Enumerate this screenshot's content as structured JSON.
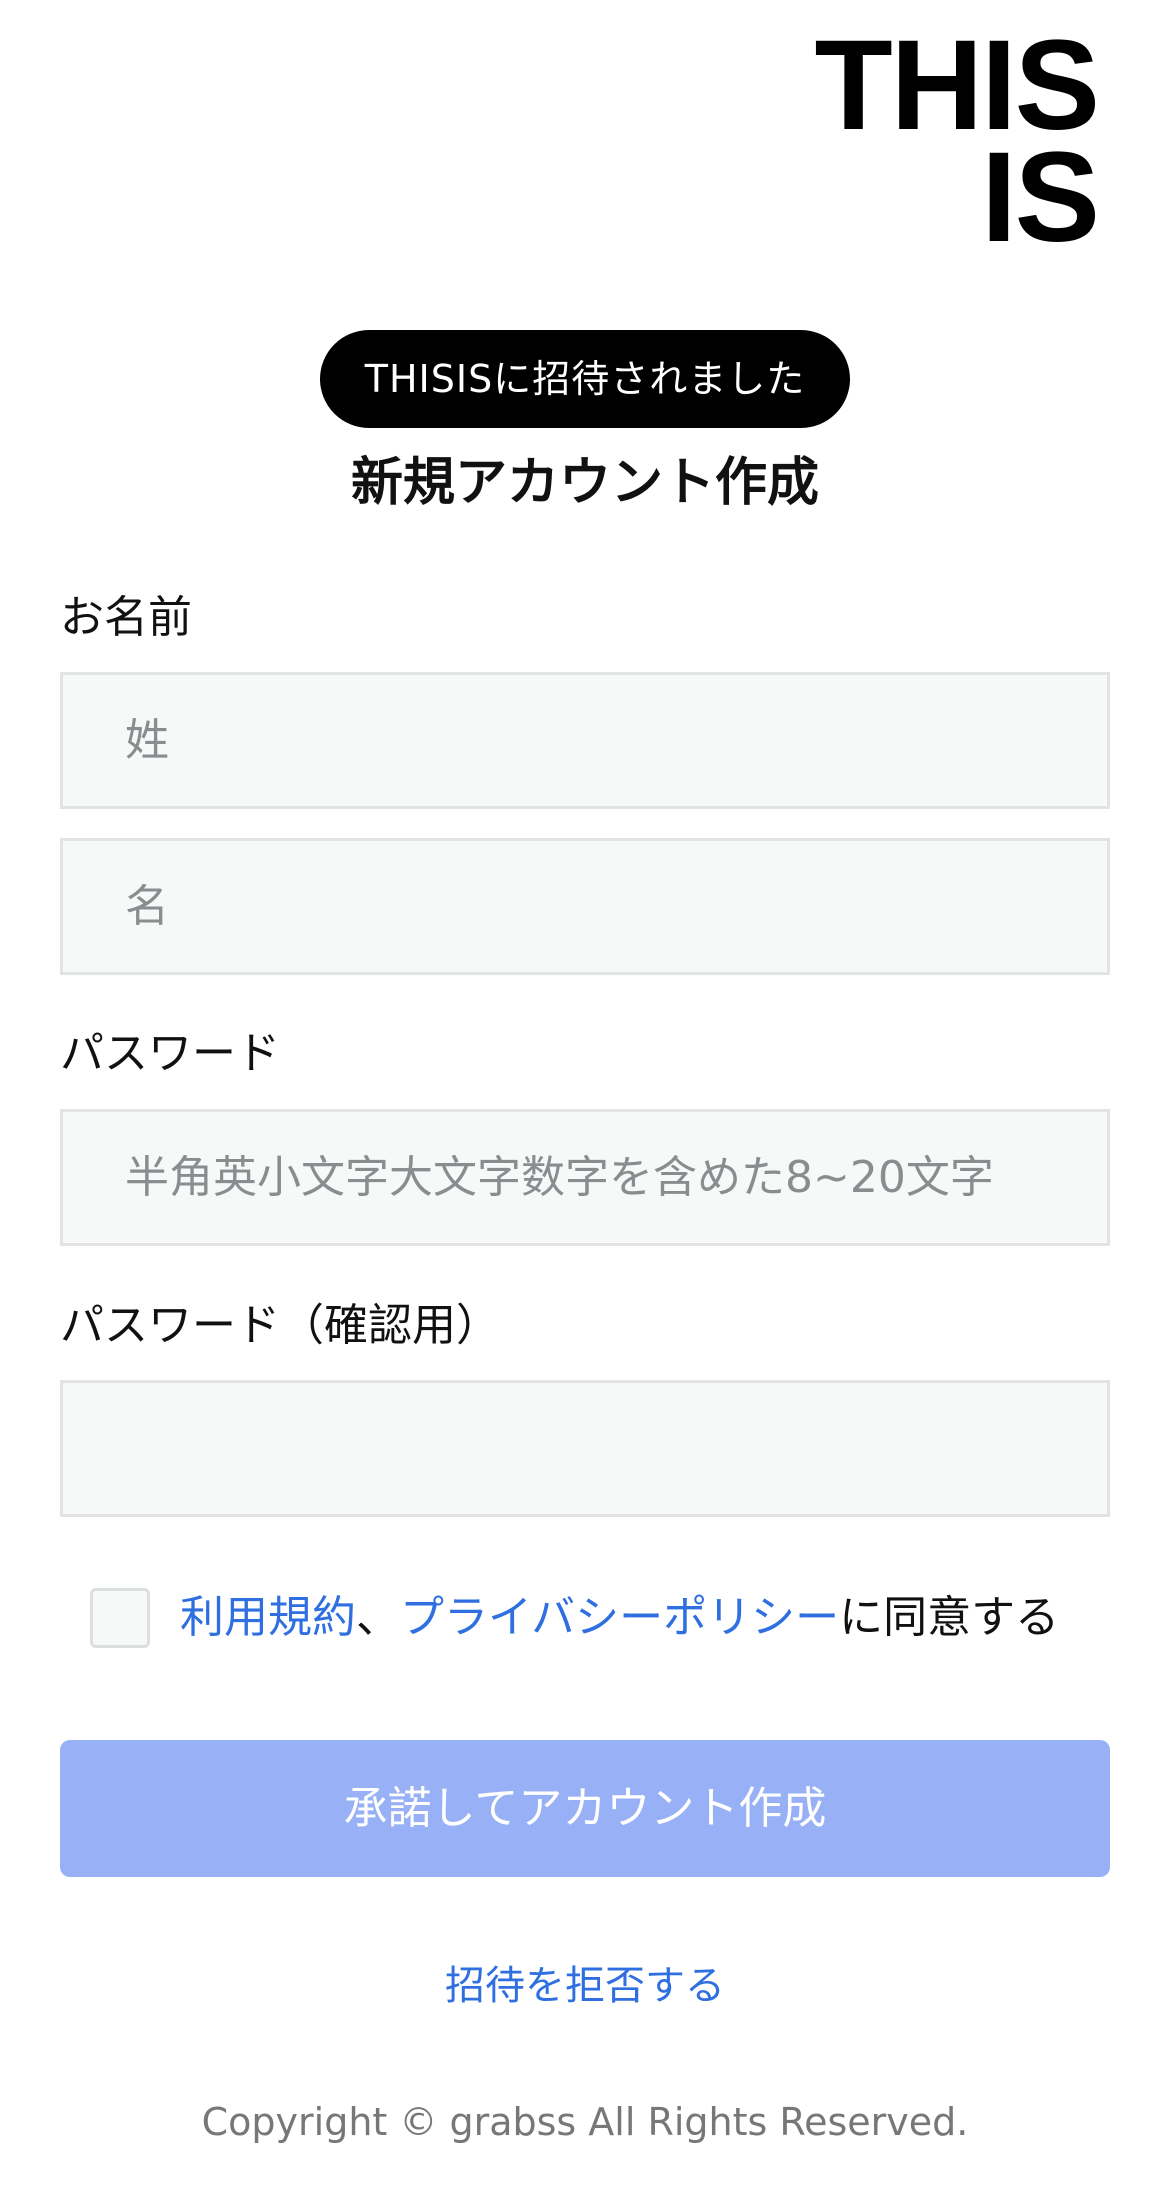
{
  "logo": {
    "line1": "THIS",
    "line2": "IS"
  },
  "invite_badge": "THISISに招待されました",
  "page_title": "新規アカウント作成",
  "form": {
    "name_label": "お名前",
    "last_name_placeholder": "姓",
    "first_name_placeholder": "名",
    "password_label": "パスワード",
    "password_placeholder": "半角英小文字大文字数字を含めた8~20文字",
    "password_confirm_label": "パスワード（確認用）",
    "password_confirm_placeholder": ""
  },
  "agreement": {
    "terms_link": "利用規約",
    "separator": "、",
    "privacy_link": "プライバシーポリシー",
    "suffix": "に同意する",
    "checked": false
  },
  "submit_button": "承諾してアカウント作成",
  "decline_link": "招待を拒否する",
  "footer": {
    "copyright": "Copyright © grabss All Rights Reserved."
  },
  "colors": {
    "accent": "#2f6fe0",
    "button_disabled": "#98b1f6",
    "badge_bg": "#000000",
    "field_bg": "#f7f8f8"
  }
}
